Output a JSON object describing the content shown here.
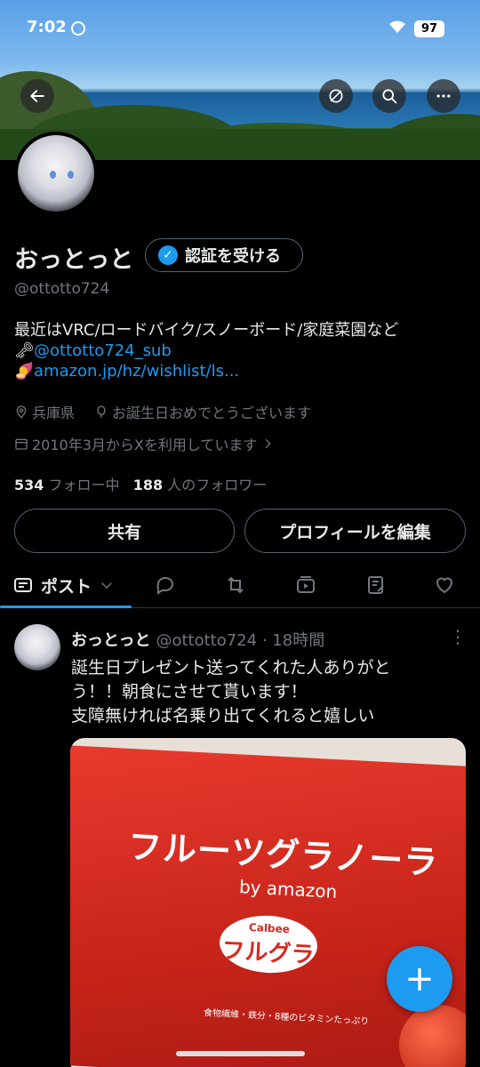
{
  "status_bar": {
    "time": "7:02",
    "battery": "97"
  },
  "profile": {
    "name": "おっとっと",
    "verify_label": "認証を受ける",
    "handle": "@ottotto724",
    "bio_line1": "最近はVRC/ロードバイク/スノーボード/家庭菜園など",
    "bio_link1": "@ottotto724_sub",
    "bio_link2": "amazon.jp/hz/wishlist/ls...",
    "location": "兵庫県",
    "birthday": "お誕生日おめでとうございます",
    "joined": "2010年3月からXを利用しています",
    "following_count": "534",
    "following_label": "フォロー中",
    "followers_count": "188",
    "followers_label": "人のフォロワー",
    "share_label": "共有",
    "edit_label": "プロフィールを編集"
  },
  "tabs": {
    "active_label": "ポスト"
  },
  "post": {
    "author": "おっとっと",
    "handle": "@ottotto724",
    "separator": "·",
    "time": "18時間",
    "text": "誕生日プレゼント送ってくれた人ありがと\nう！！朝食にさせて貰います！\n支障無ければ名乗り出てくれると嬉しい",
    "image_text": {
      "title": "フルーツグラノーラ",
      "by": "by amazon",
      "brand": "Calbee",
      "product": "フルグラ",
      "sub": "食物繊維・鉄分・8種のビタミンたっぷり"
    }
  },
  "icons": [
    "back-arrow-icon",
    "translate-icon",
    "search-icon",
    "more-icon",
    "verified-badge-icon",
    "key-icon",
    "sweet-potato-icon",
    "location-icon",
    "balloon-icon",
    "calendar-icon",
    "chevron-right-icon",
    "posts-icon",
    "chevron-down-icon",
    "reply-icon",
    "repost-icon",
    "media-icon",
    "article-icon",
    "like-icon",
    "plus-icon"
  ],
  "accent_color": "#1d9bf0"
}
